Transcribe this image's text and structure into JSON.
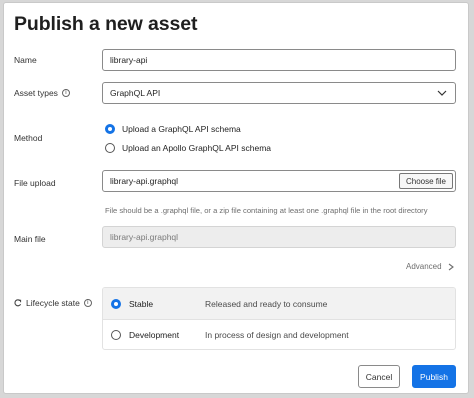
{
  "title": "Publish a new asset",
  "form": {
    "name_label": "Name",
    "name_value": "library-api",
    "asset_types_label": "Asset types",
    "asset_types_value": "GraphQL API",
    "method_label": "Method",
    "method_options": [
      {
        "label": "Upload a GraphQL API schema",
        "selected": true
      },
      {
        "label": "Upload an Apollo GraphQL API schema",
        "selected": false
      }
    ],
    "file_upload_label": "File upload",
    "file_upload_value": "library-api.graphql",
    "choose_file_label": "Choose file",
    "file_help": "File should be a .graphql file, or a zip file containing at least one .graphql file in the root directory",
    "main_file_label": "Main file",
    "main_file_value": "library-api.graphql",
    "advanced_label": "Advanced",
    "lifecycle_label": "Lifecycle state",
    "lifecycle_options": [
      {
        "name": "Stable",
        "description": "Released and ready to consume",
        "selected": true
      },
      {
        "name": "Development",
        "description": "In process of design and development",
        "selected": false
      }
    ]
  },
  "actions": {
    "cancel_label": "Cancel",
    "publish_label": "Publish"
  },
  "colors": {
    "accent": "#1473e6"
  },
  "icons": {
    "info": "info-icon",
    "chevron": "chevron-down-icon",
    "advanced": "chevron-right-icon",
    "lifecycle": "lifecycle-icon"
  }
}
